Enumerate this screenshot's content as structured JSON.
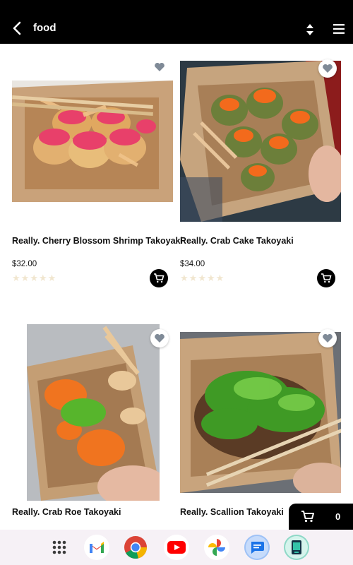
{
  "header": {
    "title": "food",
    "back_icon": "back-arrow-icon",
    "sort_icon": "sort-icon",
    "menu_icon": "hamburger-menu-icon"
  },
  "products": [
    {
      "name": "Really. Cherry Blossom Shrimp Takoyaki",
      "price": "$32.00",
      "rating": 0,
      "max_rating": 5,
      "favorite": false
    },
    {
      "name": "Really. Crab Cake Takoyaki",
      "price": "$34.00",
      "rating": 0,
      "max_rating": 5,
      "favorite": false
    },
    {
      "name": "Really. Crab Roe Takoyaki",
      "price": "",
      "rating": 0,
      "max_rating": 5,
      "favorite": false
    },
    {
      "name": "Really. Scallion Takoyaki",
      "price": "",
      "rating": 0,
      "max_rating": 5,
      "favorite": false
    }
  ],
  "cart": {
    "count": "0",
    "icon": "cart-icon"
  },
  "dock": [
    {
      "name": "app-drawer",
      "icon": "app-grid-icon"
    },
    {
      "name": "gmail",
      "icon": "gmail-icon"
    },
    {
      "name": "chrome",
      "icon": "chrome-icon"
    },
    {
      "name": "youtube",
      "icon": "youtube-icon"
    },
    {
      "name": "photos",
      "icon": "photos-icon"
    },
    {
      "name": "messages",
      "icon": "messages-icon"
    },
    {
      "name": "app",
      "icon": "app-icon"
    }
  ],
  "colors": {
    "header_bg": "#000000",
    "fav_heart": "#7f8a97",
    "star_empty": "#f1e6cf",
    "dock_bg": "#f6f1f6"
  }
}
